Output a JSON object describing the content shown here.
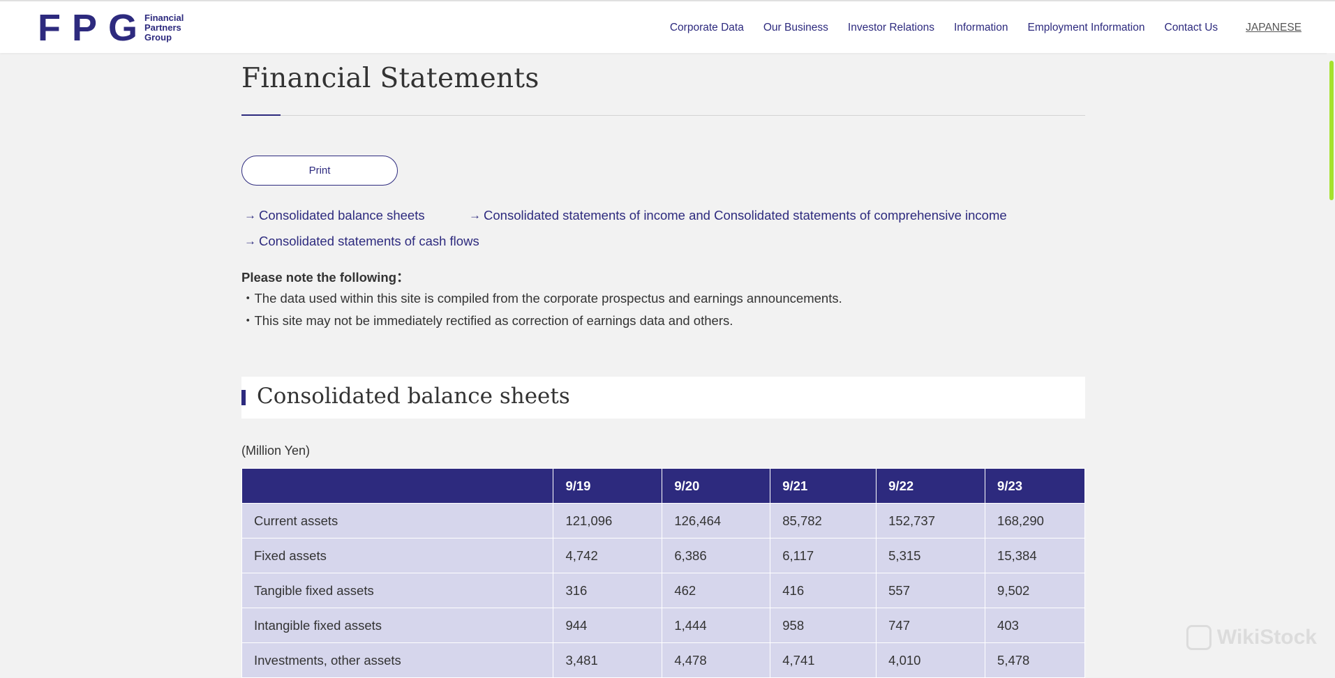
{
  "header": {
    "logo_mark": "FPG",
    "logo_lines": [
      "Financial",
      "Partners",
      "Group"
    ],
    "nav": [
      "Corporate Data",
      "Our Business",
      "Investor Relations",
      "Information",
      "Employment Information",
      "Contact Us"
    ],
    "language": "JAPANESE"
  },
  "page": {
    "title": "Financial Statements",
    "print_label": "Print",
    "arrow_glyph": "→",
    "anchors": [
      "Consolidated balance sheets",
      "Consolidated statements of income and Consolidated statements of comprehensive income",
      "Consolidated statements of cash flows"
    ],
    "note_title": "Please note the following：",
    "notes": [
      "・The data used within this site is compiled from the corporate prospectus and earnings announcements.",
      "・This site may not be immediately rectified as correction of earnings data and others."
    ]
  },
  "balance_sheet": {
    "heading": "Consolidated balance sheets",
    "unit": "(Million Yen)",
    "columns": [
      "",
      "9/19",
      "9/20",
      "9/21",
      "9/22",
      "9/23"
    ],
    "rows": [
      [
        "Current assets",
        "121,096",
        "126,464",
        "85,782",
        "152,737",
        "168,290"
      ],
      [
        "Fixed assets",
        "4,742",
        "6,386",
        "6,117",
        "5,315",
        "15,384"
      ],
      [
        "Tangible fixed assets",
        "316",
        "462",
        "416",
        "557",
        "9,502"
      ],
      [
        "Intangible fixed assets",
        "944",
        "1,444",
        "958",
        "747",
        "403"
      ],
      [
        "Investments, other assets",
        "3,481",
        "4,478",
        "4,741",
        "4,010",
        "5,478"
      ]
    ]
  },
  "watermark": "WikiStock"
}
